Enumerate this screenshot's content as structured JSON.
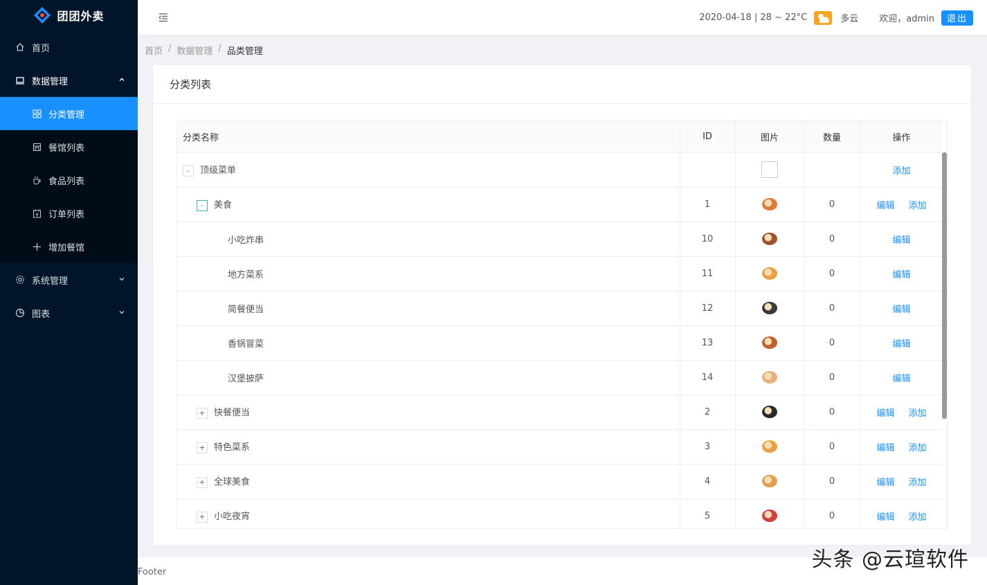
{
  "app": {
    "logo_text": "团团外卖"
  },
  "sidebar": {
    "items": [
      {
        "label": "首页",
        "icon": "home-icon"
      },
      {
        "label": "数据管理",
        "icon": "laptop-icon",
        "arrow": "⌃"
      },
      {
        "label": "系统管理",
        "icon": "gear-icon",
        "arrow": "⌄"
      },
      {
        "label": "图表",
        "icon": "pie-chart-icon",
        "arrow": "⌄"
      }
    ],
    "sub_items": [
      {
        "label": "分类管理",
        "icon": "appstore-icon"
      },
      {
        "label": "餐馆列表",
        "icon": "shop-icon"
      },
      {
        "label": "食品列表",
        "icon": "coffee-icon"
      },
      {
        "label": "订单列表",
        "icon": "order-icon"
      },
      {
        "label": "增加餐馆",
        "icon": "plus-icon"
      }
    ]
  },
  "header": {
    "date_weather": "2020-04-18 | 28 ~ 22°C",
    "weather": "多云",
    "welcome": "欢迎，admin",
    "logout": "退出"
  },
  "breadcrumb": {
    "home": "首页",
    "sep": "/",
    "data": "数据管理",
    "current": "品类管理"
  },
  "card": {
    "title": "分类列表"
  },
  "table": {
    "headers": {
      "name": "分类名称",
      "id": "ID",
      "image": "图片",
      "count": "数量",
      "action": "操作"
    },
    "edit_label": "编辑",
    "add_label": "添加",
    "rows": [
      {
        "name": "顶级菜单",
        "id": "",
        "count": "",
        "expander": "-",
        "level": 0,
        "thumb": "empty",
        "actions": "add"
      },
      {
        "name": "美食",
        "id": "1",
        "count": "0",
        "expander": "-",
        "level": 1,
        "thumb": "#e07b3c",
        "actions": "both"
      },
      {
        "name": "小吃炸串",
        "id": "10",
        "count": "0",
        "expander": "",
        "level": 2,
        "thumb": "#a0522d",
        "actions": "edit"
      },
      {
        "name": "地方菜系",
        "id": "11",
        "count": "0",
        "expander": "",
        "level": 2,
        "thumb": "#e8a040",
        "actions": "edit"
      },
      {
        "name": "简餐便当",
        "id": "12",
        "count": "0",
        "expander": "",
        "level": 2,
        "thumb": "#3a3a3a",
        "actions": "edit"
      },
      {
        "name": "香锅冒菜",
        "id": "13",
        "count": "0",
        "expander": "",
        "level": 2,
        "thumb": "#c0602a",
        "actions": "edit"
      },
      {
        "name": "汉堡披萨",
        "id": "14",
        "count": "0",
        "expander": "",
        "level": 2,
        "thumb": "#e8b080",
        "actions": "edit"
      },
      {
        "name": "快餐便当",
        "id": "2",
        "count": "0",
        "expander": "+",
        "level": 1,
        "thumb": "#2a2a2a",
        "actions": "both"
      },
      {
        "name": "特色菜系",
        "id": "3",
        "count": "0",
        "expander": "+",
        "level": 1,
        "thumb": "#e8a040",
        "actions": "both"
      },
      {
        "name": "全球美食",
        "id": "4",
        "count": "0",
        "expander": "+",
        "level": 1,
        "thumb": "#e0a050",
        "actions": "both"
      },
      {
        "name": "小吃夜宵",
        "id": "5",
        "count": "0",
        "expander": "+",
        "level": 1,
        "thumb": "#d04040",
        "actions": "both"
      }
    ]
  },
  "footer": {
    "text": "Footer"
  },
  "watermark": {
    "text": "头条 @云瑄软件"
  }
}
